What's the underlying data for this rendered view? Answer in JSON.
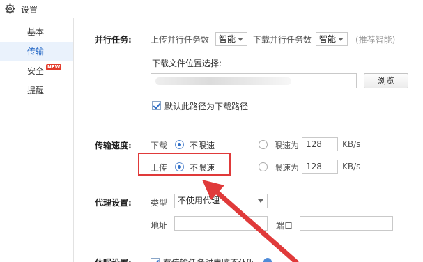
{
  "window": {
    "title": "设置",
    "icon": "gear-icon"
  },
  "sidebar": {
    "items": [
      {
        "label": "基本",
        "active": false
      },
      {
        "label": "传输",
        "active": true
      },
      {
        "label": "安全",
        "badge": "NEW",
        "active": false
      },
      {
        "label": "提醒",
        "active": false
      }
    ]
  },
  "parallel": {
    "section_label": "并行任务:",
    "upload_label": "上传并行任务数",
    "upload_value": "智能",
    "download_label": "下载并行任务数",
    "download_value": "智能",
    "hint": "(推荐智能)"
  },
  "download_location": {
    "label": "下载文件位置选择:",
    "path_value": "",
    "browse_label": "浏览",
    "default_checkbox_label": "默认此路径为下载路径",
    "default_checked": true
  },
  "speed": {
    "section_label": "传输速度:",
    "download": {
      "label": "下载",
      "unlimited_label": "不限速",
      "limit_label": "限速为",
      "limit_value": "128",
      "unit": "KB/s",
      "unlimited_selected": true
    },
    "upload": {
      "label": "上传",
      "unlimited_label": "不限速",
      "limit_label": "限速为",
      "limit_value": "128",
      "unit": "KB/s",
      "unlimited_selected": true
    }
  },
  "proxy": {
    "section_label": "代理设置:",
    "type_label": "类型",
    "type_value": "不使用代理",
    "address_label": "地址",
    "address_value": "",
    "port_label": "端口",
    "port_value": ""
  },
  "sleep": {
    "section_label": "休眠设置:",
    "checkbox_label": "有传输任务时电脑不休眠",
    "checked": true
  },
  "annotation": {
    "color": "#e03a3a"
  }
}
